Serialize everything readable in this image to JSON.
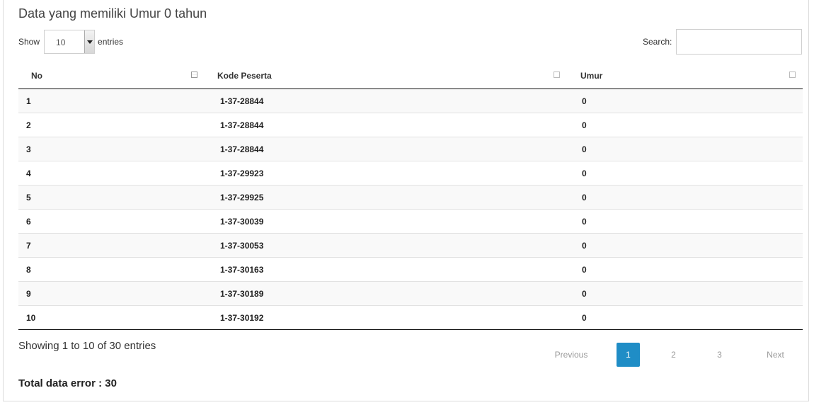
{
  "panel": {
    "title": "Data yang memiliki Umur 0 tahun"
  },
  "controls": {
    "show_label": "Show",
    "entries_value": "10",
    "entries_label": "entries",
    "search_label": "Search:",
    "search_value": ""
  },
  "table": {
    "columns": [
      "No",
      "Kode Peserta",
      "Umur"
    ],
    "rows": [
      [
        "1",
        "1-37-28844",
        "0"
      ],
      [
        "2",
        "1-37-28844",
        "0"
      ],
      [
        "3",
        "1-37-28844",
        "0"
      ],
      [
        "4",
        "1-37-29923",
        "0"
      ],
      [
        "5",
        "1-37-29925",
        "0"
      ],
      [
        "6",
        "1-37-30039",
        "0"
      ],
      [
        "7",
        "1-37-30053",
        "0"
      ],
      [
        "8",
        "1-37-30163",
        "0"
      ],
      [
        "9",
        "1-37-30189",
        "0"
      ],
      [
        "10",
        "1-37-30192",
        "0"
      ]
    ]
  },
  "footer": {
    "info": "Showing 1 to 10 of 30 entries",
    "pagination": {
      "previous": "Previous",
      "pages": [
        "1",
        "2",
        "3"
      ],
      "current": "1",
      "next": "Next"
    },
    "total": "Total data error : 30"
  },
  "colors": {
    "accent": "#1f8dc6",
    "border": "#dcdcdc",
    "stripe": "#f9f9f9"
  }
}
